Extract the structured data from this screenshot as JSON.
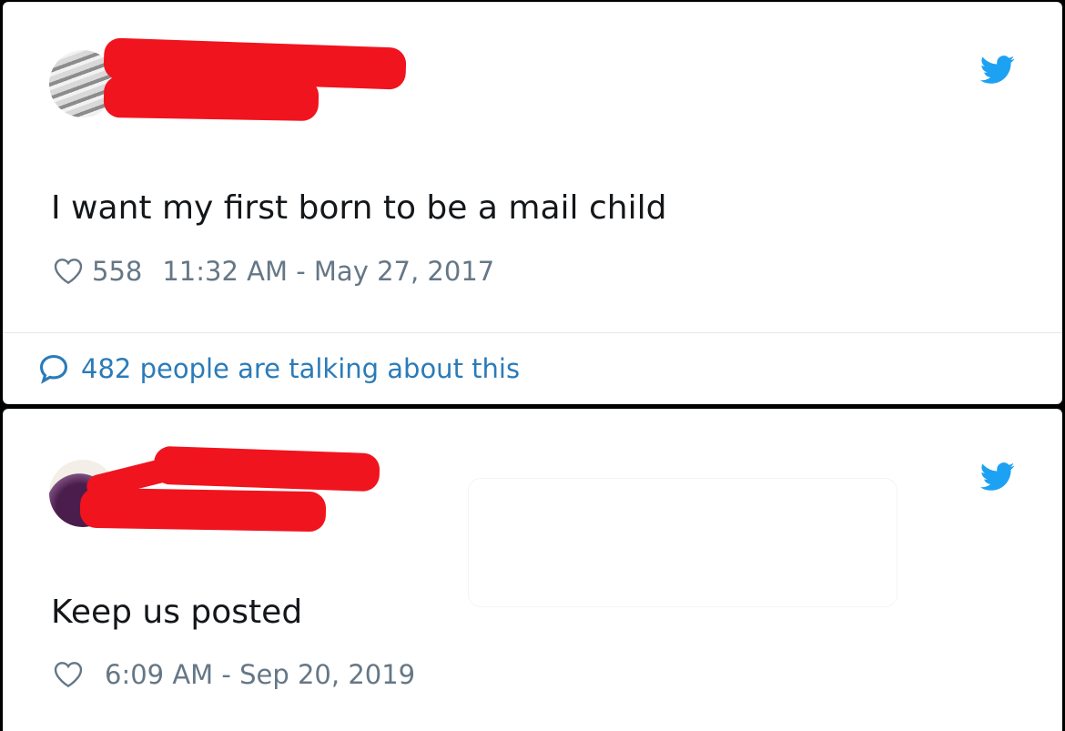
{
  "colors": {
    "twitter_blue": "#1da1f2",
    "link_blue": "#2b7bb9",
    "text_dark": "#14171a",
    "text_gray": "#657786",
    "redaction_red": "#f0141e"
  },
  "tweets": [
    {
      "text": "I want my first born to be a mail child",
      "like_count": "558",
      "timestamp": "11:32 AM - May 27, 2017",
      "conversation_link": "482 people are talking about this",
      "icons": {
        "like": "heart-outline-icon",
        "brand": "twitter-bird-icon",
        "reply": "speech-bubble-icon"
      }
    },
    {
      "text": "Keep us posted",
      "like_count": "",
      "timestamp": "6:09 AM - Sep 20, 2019",
      "icons": {
        "like": "heart-outline-icon",
        "brand": "twitter-bird-icon"
      }
    }
  ]
}
